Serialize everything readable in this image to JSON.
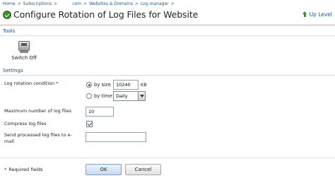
{
  "breadcrumb": {
    "home": "Home",
    "subscriptions": "Subscriptions",
    "domain_suffix": "com",
    "websites_domains": "Websites & Domains",
    "log_manager": "Log manager",
    "separator": ">"
  },
  "header": {
    "title": "Configure Rotation of Log Files for Website",
    "up_level": "Up Level"
  },
  "tools": {
    "section_title": "Tools",
    "switch_off_label": "Switch Off"
  },
  "settings": {
    "section_title": "Settings",
    "rotation_condition_label": "Log rotation condition",
    "required_marker": "*",
    "by_size_label": "by size",
    "by_size_value": "10240",
    "by_size_unit": "KB",
    "by_time_label": "by time",
    "by_time_selected": "Daily",
    "selected_condition": "by size",
    "max_log_files_label": "Maximum number of log files",
    "max_log_files_value": "10",
    "compress_label": "Compress log files",
    "compress_checked": true,
    "send_email_label_line1": "Send processed log files to e-",
    "send_email_label_line2": "mail",
    "send_email_value": ""
  },
  "footer": {
    "required_note_marker": "*",
    "required_note": "Required fields",
    "ok_label": "OK",
    "cancel_label": "Cancel"
  },
  "colors": {
    "link": "#1d5aa3",
    "section_rule": "#9ab8d8",
    "title_icon": "#3d8f2f",
    "required": "#cc0000"
  },
  "icons": {
    "title": "check-circle-icon",
    "up_level": "up-arrow-icon",
    "switch_off": "switch-off-icon"
  }
}
